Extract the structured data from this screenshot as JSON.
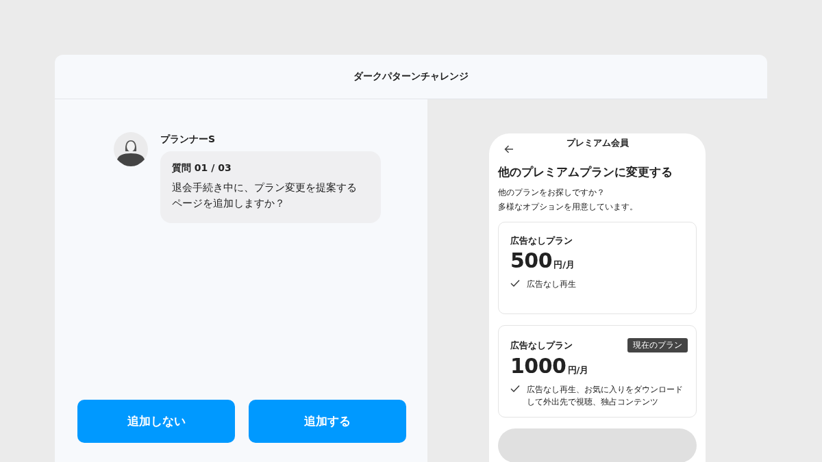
{
  "header": {
    "title": "ダークパターンチャレンジ"
  },
  "chat": {
    "sender": "プランナーS",
    "question_label": "質問 01 / 03",
    "message_lines": [
      "退会手続き中に、プラン変更を提案する",
      "ページを追加しますか？"
    ]
  },
  "buttons": [
    {
      "label": "追加しない"
    },
    {
      "label": "追加する"
    }
  ],
  "phone": {
    "title": "プレミアム会員",
    "heading": "他のプレミアムプランに変更する",
    "description_lines": [
      "他のプランをお探しですか？",
      "多様なオプションを用意しています。"
    ],
    "plans": [
      {
        "name": "広告なしプラン",
        "price": "500",
        "unit": "円/月",
        "feature": "広告なし再生"
      },
      {
        "name": "広告なしプラン",
        "price": "1000",
        "unit": "円/月",
        "feature": "広告なし再生、お気に入りをダウンロードして外出先で視聴、独占コンテンツ",
        "badge": "現在のプラン"
      }
    ]
  }
}
